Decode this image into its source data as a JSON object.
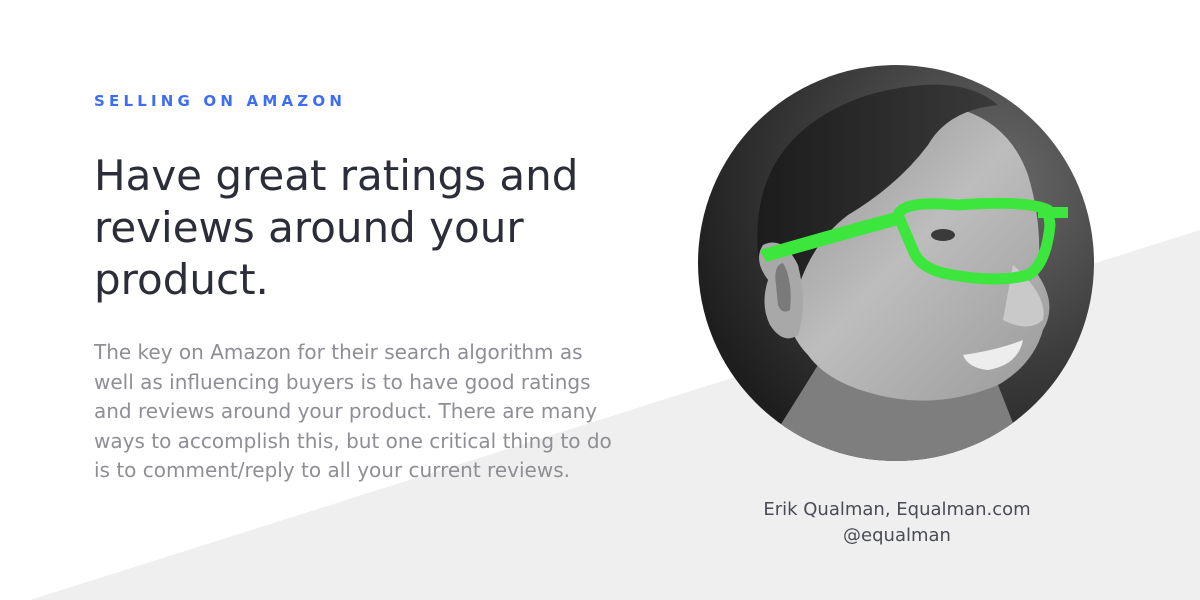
{
  "category": "SELLING ON AMAZON",
  "headline": "Have great ratings and reviews around your product.",
  "body": "The key on Amazon for their search algorithm as well as influencing buyers is to have good ratings and reviews around your product. There are many ways to accomplish this, but one critical thing to do is to comment/reply to all your current reviews.",
  "credit": {
    "name": "Erik Qualman, Equalman.com",
    "handle": "@equalman"
  },
  "colors": {
    "accent": "#3d6df2",
    "headline": "#2b2d38",
    "body": "#8e8e94",
    "background_shape": "#efefef",
    "glasses": "#3ce63c"
  },
  "portrait": {
    "description_icon": "person-photo-icon"
  }
}
